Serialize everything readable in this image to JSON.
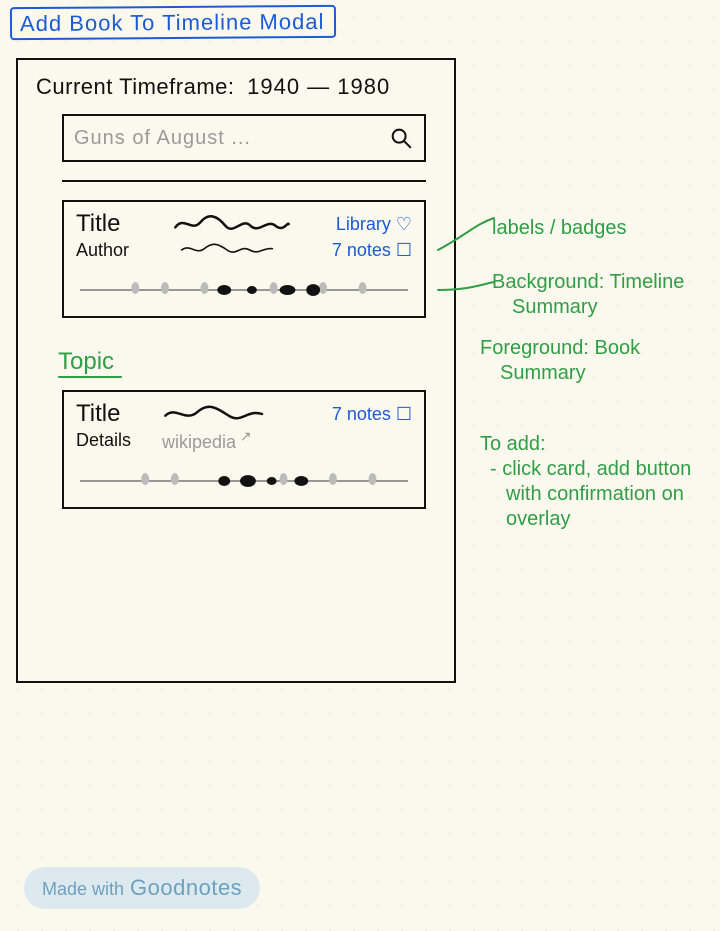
{
  "page_title": "Add Book To Timeline Modal",
  "modal": {
    "timeframe_label": "Current Timeframe:",
    "timeframe_value": "1940 — 1980",
    "search_placeholder": "Guns of August ..."
  },
  "card1": {
    "title_label": "Title",
    "author_label": "Author",
    "badge_library": "Library ♡",
    "badge_notes": "7 notes ☐"
  },
  "section_topic": "Topic",
  "card2": {
    "title_label": "Title",
    "details_label": "Details",
    "details_source": "wikipedia",
    "badge_notes": "7 notes ☐"
  },
  "annotations": {
    "labels_badges": "labels / badges",
    "bg_line1": "Background: Timeline",
    "bg_line2": "Summary",
    "fg_line1": "Foreground: Book",
    "fg_line2": "Summary",
    "todo_head": "To add:",
    "todo_l1": "- click card, add button",
    "todo_l2": "with confirmation on",
    "todo_l3": "overlay"
  },
  "footer": {
    "prefix": "Made with",
    "brand": "Goodnotes"
  }
}
